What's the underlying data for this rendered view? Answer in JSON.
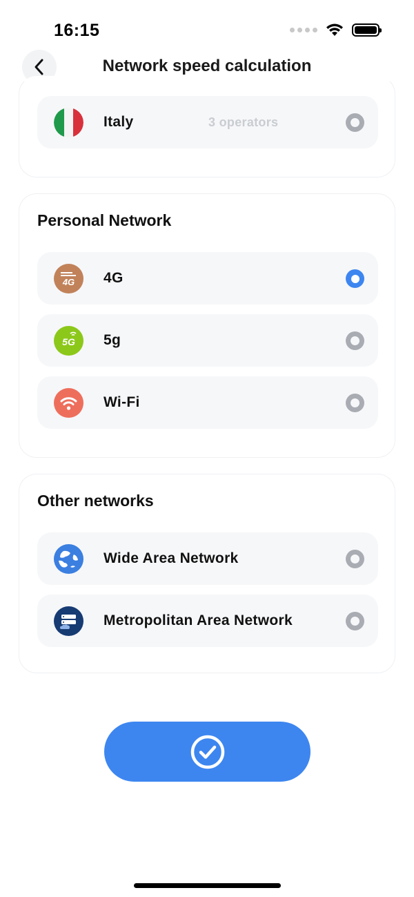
{
  "status_bar": {
    "time": "16:15"
  },
  "nav": {
    "title": "Network speed calculation"
  },
  "country": {
    "label": "Italy",
    "meta": "3 operators",
    "selected": false
  },
  "personal": {
    "title": "Personal Network",
    "items": [
      {
        "label": "4G",
        "icon": "4g-icon",
        "color": "#c1825a",
        "selected": true
      },
      {
        "label": "5g",
        "icon": "5g-icon",
        "color": "#8cc81a",
        "selected": false
      },
      {
        "label": "Wi-Fi",
        "icon": "wifi-icon",
        "color": "#ee6e5c",
        "selected": false
      }
    ]
  },
  "other": {
    "title": "Other networks",
    "items": [
      {
        "label": "Wide Area Network",
        "icon": "globe-icon",
        "color": "#3b7fe0",
        "selected": false
      },
      {
        "label": "Metropolitan Area Network",
        "icon": "server-cloud-icon",
        "color": "#173b73",
        "selected": false
      }
    ]
  },
  "colors": {
    "accent": "#3d86f0",
    "radio_off": "#a9acb2",
    "row_bg": "#f6f7f9"
  }
}
